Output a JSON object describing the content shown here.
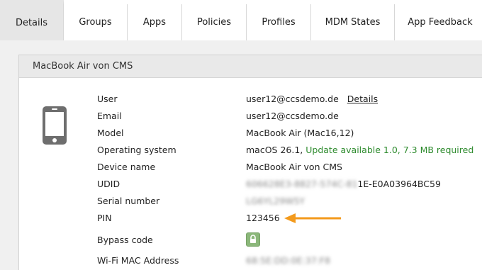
{
  "tabs": [
    {
      "label": "Details",
      "active": true
    },
    {
      "label": "Groups"
    },
    {
      "label": "Apps"
    },
    {
      "label": "Policies"
    },
    {
      "label": "Profiles"
    },
    {
      "label": "MDM States"
    },
    {
      "label": "App Feedback"
    }
  ],
  "panel": {
    "title": "MacBook Air von CMS",
    "device_icon": "smartphone-icon"
  },
  "details": {
    "user_label": "User",
    "user_value": "user12@ccsdemo.de",
    "user_link": "Details",
    "email_label": "Email",
    "email_value": "user12@ccsdemo.de",
    "model_label": "Model",
    "model_value": "MacBook Air (Mac16,12)",
    "os_label": "Operating system",
    "os_value": "macOS 26.1,",
    "os_update": "Update available 1.0, 7.3 MB required",
    "device_name_label": "Device name",
    "device_name_value": "MacBook Air von CMS",
    "udid_label": "UDID",
    "udid_value_blurred": "606628E3-8827-574C-81",
    "udid_value_visible": "1E-E0A03964BC59",
    "serial_label": "Serial number",
    "serial_value_blurred": "LG6YL29W5Y",
    "pin_label": "PIN",
    "pin_value": "123456",
    "bypass_label": "Bypass code",
    "bypass_icon": "lock-icon",
    "wifi_label": "Wi-Fi MAC Address",
    "wifi_value_blurred": "68:5E:DD:0E:37:F8"
  },
  "colors": {
    "update_green": "#2e8b2e",
    "arrow_orange": "#f39a1c",
    "lock_button": "#8bb77a"
  }
}
